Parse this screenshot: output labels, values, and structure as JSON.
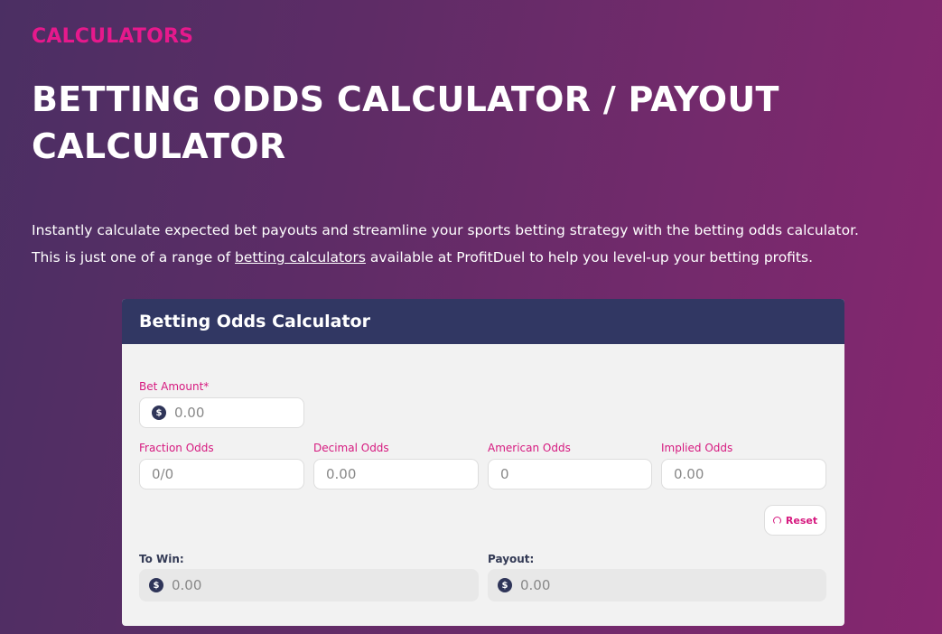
{
  "page": {
    "eyebrow": "CALCULATORS",
    "title": "BETTING ODDS CALCULATOR / PAYOUT CALCULATOR",
    "intro_line1": "Instantly calculate expected bet payouts and streamline your sports betting strategy with the betting odds calculator.",
    "intro_line2_before": "This is just one of a range of ",
    "intro_link": "betting calculators",
    "intro_line2_after": " available at ProfitDuel to help you level-up your betting profits."
  },
  "calculator": {
    "title": "Betting Odds Calculator",
    "bet_amount": {
      "label": "Bet Amount*",
      "placeholder": "0.00",
      "value": ""
    },
    "fraction_odds": {
      "label": "Fraction Odds",
      "placeholder": "0/0",
      "value": ""
    },
    "decimal_odds": {
      "label": "Decimal Odds",
      "placeholder": "0.00",
      "value": ""
    },
    "american_odds": {
      "label": "American Odds",
      "placeholder": "0",
      "value": ""
    },
    "implied_odds": {
      "label": "Implied Odds",
      "placeholder": "0.00",
      "value": ""
    },
    "reset_label": "Reset",
    "to_win": {
      "label": "To Win:",
      "value": "0.00"
    },
    "payout": {
      "label": "Payout:",
      "value": "0.00"
    },
    "currency_symbol": "$"
  },
  "colors": {
    "accent": "#e6198c",
    "header": "#313763",
    "background_start": "#4b2f63",
    "background_end": "#86266f"
  },
  "icons": {
    "currency": "dollar-coin-icon",
    "reset": "refresh-icon"
  }
}
